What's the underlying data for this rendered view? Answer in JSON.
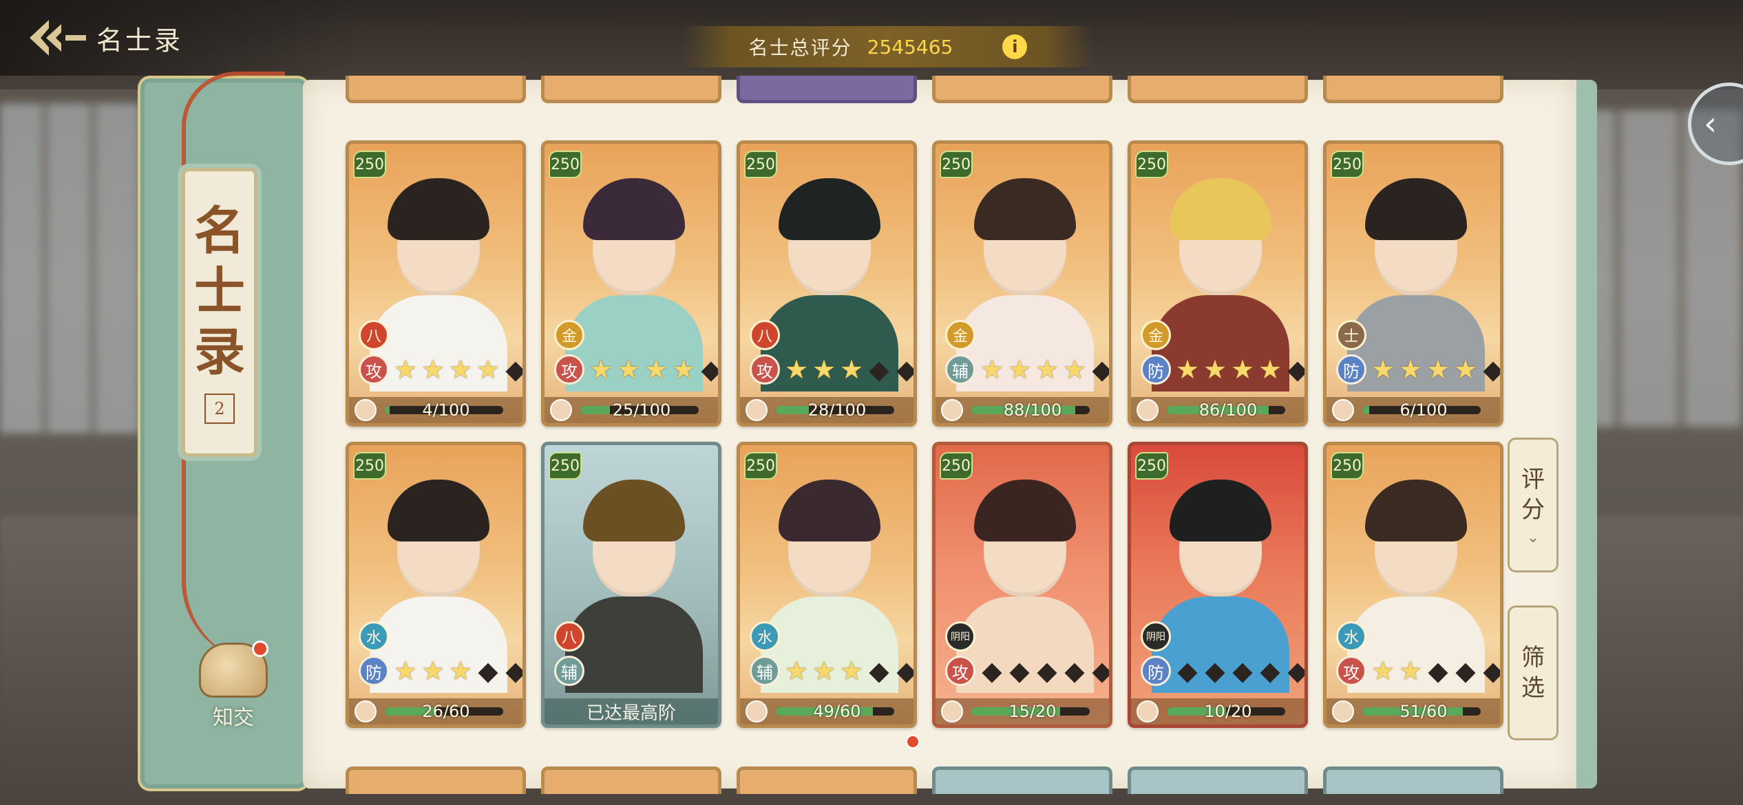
{
  "header": {
    "title": "名士录",
    "back_icon": "back-arrow-icon"
  },
  "score": {
    "label": "名士总评分",
    "value": "2545465",
    "info_icon": "i"
  },
  "book": {
    "title_chars": [
      "名",
      "士",
      "录"
    ],
    "seal_number": "2",
    "friend_label": "知交"
  },
  "side_buttons": {
    "sort": [
      "评",
      "分"
    ],
    "filter": [
      "筛",
      "选"
    ]
  },
  "cards": [
    {
      "level": "250",
      "element": "八",
      "element_color": "#d0452e",
      "role": "攻",
      "role_color": "#c9534a",
      "stars_on": 4,
      "stars_off": 1,
      "progress": "4/100",
      "fill": 0.04,
      "theme": "",
      "hair": "#2a231f",
      "body": "#f4f3ee"
    },
    {
      "level": "250",
      "element": "金",
      "element_color": "#d29a2a",
      "role": "攻",
      "role_color": "#c9534a",
      "stars_on": 4,
      "stars_off": 1,
      "progress": "25/100",
      "fill": 0.25,
      "theme": "",
      "hair": "#3a2a3a",
      "body": "#9bd0c4"
    },
    {
      "level": "250",
      "element": "八",
      "element_color": "#d0452e",
      "role": "攻",
      "role_color": "#c9534a",
      "stars_on": 3,
      "stars_off": 2,
      "progress": "28/100",
      "fill": 0.28,
      "theme": "",
      "hair": "#1f2422",
      "body": "#2f5a4e"
    },
    {
      "level": "250",
      "element": "金",
      "element_color": "#d29a2a",
      "role": "辅",
      "role_color": "#6f9c96",
      "stars_on": 4,
      "stars_off": 1,
      "progress": "88/100",
      "fill": 0.88,
      "theme": "",
      "hair": "#3a2a22",
      "body": "#f5e8e0"
    },
    {
      "level": "250",
      "element": "金",
      "element_color": "#d29a2a",
      "role": "防",
      "role_color": "#5b82c4",
      "stars_on": 4,
      "stars_off": 1,
      "progress": "86/100",
      "fill": 0.86,
      "theme": "",
      "hair": "#e8c65a",
      "body": "#8a3a2e"
    },
    {
      "level": "250",
      "element": "士",
      "element_color": "#8a6a4a",
      "role": "防",
      "role_color": "#5b82c4",
      "stars_on": 4,
      "stars_off": 1,
      "progress": "6/100",
      "fill": 0.06,
      "theme": "",
      "hair": "#2a231f",
      "body": "#9aa0a4"
    },
    {
      "level": "250",
      "element": "水",
      "element_color": "#3a9ab8",
      "role": "防",
      "role_color": "#5b82c4",
      "stars_on": 3,
      "stars_off": 2,
      "progress": "26/60",
      "fill": 0.43,
      "theme": "",
      "hair": "#2a231f",
      "body": "#f4f3ee"
    },
    {
      "level": "250",
      "element": "八",
      "element_color": "#d0452e",
      "role": "辅",
      "role_color": "#6f9c96",
      "stars_on": 0,
      "stars_off": 0,
      "progress": "已达最高阶",
      "fill": 1,
      "theme": "teal",
      "hair": "#6a5022",
      "body": "#3e3e3a"
    },
    {
      "level": "250",
      "element": "水",
      "element_color": "#3a9ab8",
      "role": "辅",
      "role_color": "#6f9c96",
      "stars_on": 3,
      "stars_off": 2,
      "progress": "49/60",
      "fill": 0.82,
      "theme": "",
      "hair": "#3a2a30",
      "body": "#e6f0da"
    },
    {
      "level": "250",
      "element": "阴阳",
      "element_color": "#2a2a2a",
      "role": "攻",
      "role_color": "#c9534a",
      "stars_on": 0,
      "stars_off": 5,
      "progress": "15/20",
      "fill": 0.75,
      "theme": "redlight",
      "hair": "#3a2520",
      "body": "#f2d9c0"
    },
    {
      "level": "250",
      "element": "阴阳",
      "element_color": "#2a2a2a",
      "role": "防",
      "role_color": "#5b82c4",
      "stars_on": 0,
      "stars_off": 5,
      "progress": "10/20",
      "fill": 0.5,
      "theme": "red",
      "hair": "#1f1f1f",
      "body": "#4aa0d0"
    },
    {
      "level": "250",
      "element": "水",
      "element_color": "#3a9ab8",
      "role": "攻",
      "role_color": "#c9534a",
      "stars_on": 2,
      "stars_off": 3,
      "progress": "51/60",
      "fill": 0.85,
      "theme": "",
      "hair": "#3a2a22",
      "body": "#f4efe2"
    }
  ]
}
